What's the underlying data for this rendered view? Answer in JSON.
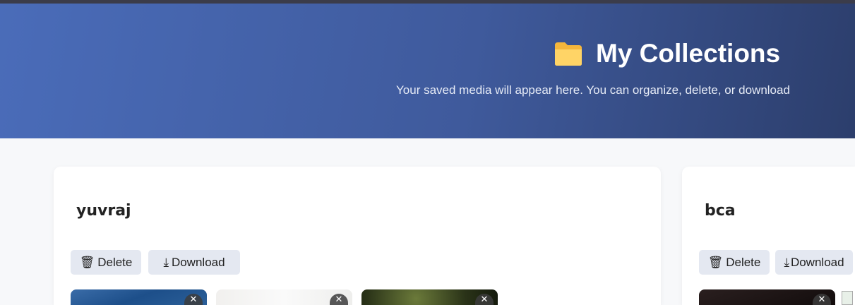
{
  "header": {
    "title": "My Collections",
    "title_icon": "folder-icon",
    "subtitle": "Your saved media will appear here. You can organize, delete, or download"
  },
  "collections": [
    {
      "name": "yuvraj",
      "delete_label": "Delete",
      "download_label": "Download",
      "remove_symbol": "✕"
    },
    {
      "name": "bca",
      "delete_label": "Delete",
      "download_label": "Download",
      "remove_symbol": "✕"
    }
  ]
}
